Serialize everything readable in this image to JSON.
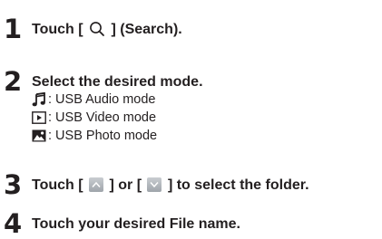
{
  "steps": [
    {
      "number": "1",
      "text_before": "Touch [",
      "icon": "search-icon",
      "text_after": "] (Search)."
    },
    {
      "number": "2",
      "title": "Select the desired mode.",
      "modes": [
        {
          "icon": "music-note-icon",
          "label": ": USB Audio mode"
        },
        {
          "icon": "video-play-icon",
          "label": ": USB Video mode"
        },
        {
          "icon": "photo-icon",
          "label": ": USB Photo mode"
        }
      ]
    },
    {
      "number": "3",
      "text_part1": "Touch [",
      "icon_up": "chevron-up-icon",
      "text_part2": "] or [",
      "icon_down": "chevron-down-icon",
      "text_part3": "] to select the folder."
    },
    {
      "number": "4",
      "title": "Touch your desired File name."
    }
  ]
}
